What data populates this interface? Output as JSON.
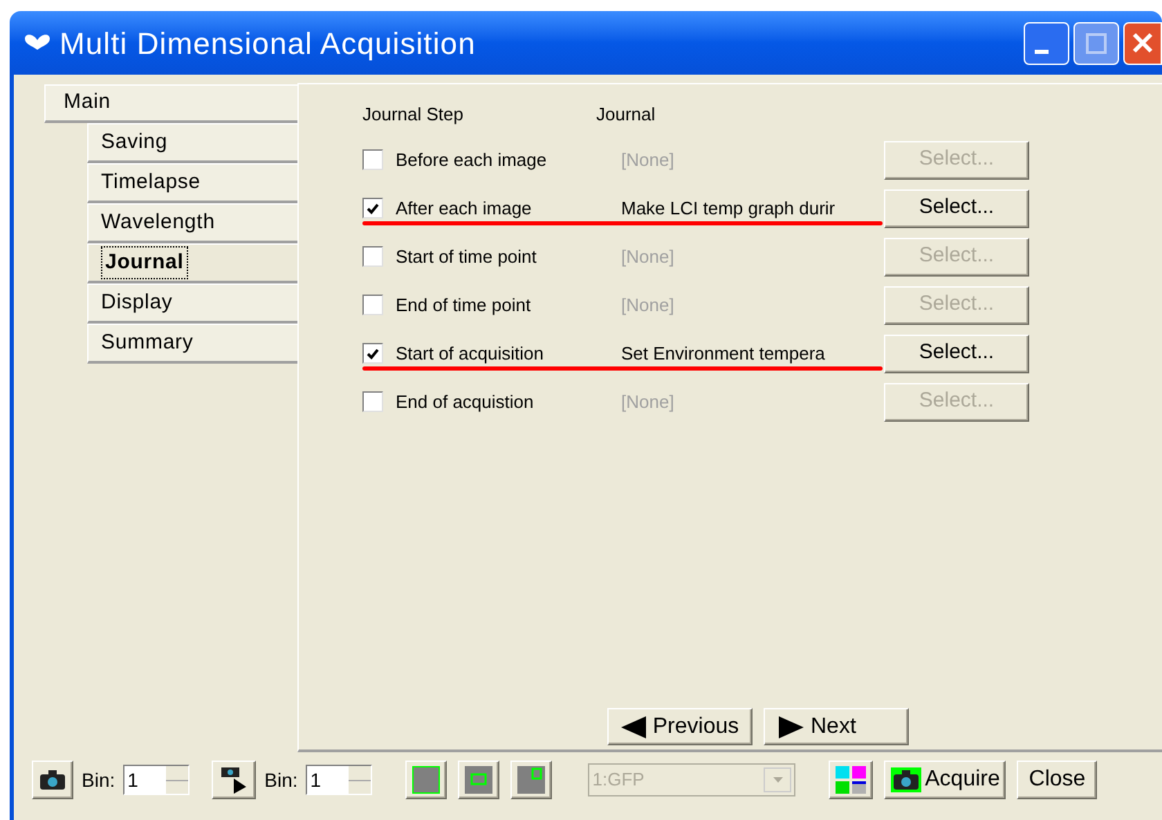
{
  "window": {
    "title": "Multi Dimensional Acquisition"
  },
  "tabs": [
    {
      "label": "Main",
      "selected": false,
      "kind": "top"
    },
    {
      "label": "Saving",
      "selected": false,
      "kind": "sub"
    },
    {
      "label": "Timelapse",
      "selected": false,
      "kind": "sub"
    },
    {
      "label": "Wavelength",
      "selected": false,
      "kind": "sub"
    },
    {
      "label": "Journal",
      "selected": true,
      "kind": "sub"
    },
    {
      "label": "Display",
      "selected": false,
      "kind": "sub"
    },
    {
      "label": "Summary",
      "selected": false,
      "kind": "sub"
    }
  ],
  "columns": [
    "Journal Step",
    "Journal"
  ],
  "steps": [
    {
      "label": "Before each image",
      "checked": false,
      "journal": "[None]",
      "button": "Select...",
      "underlined": false
    },
    {
      "label": "After each image",
      "checked": true,
      "journal": "Make LCI temp graph durir",
      "button": "Select...",
      "underlined": true
    },
    {
      "label": "Start of time point",
      "checked": false,
      "journal": "[None]",
      "button": "Select...",
      "underlined": false
    },
    {
      "label": "End of time point",
      "checked": false,
      "journal": "[None]",
      "button": "Select...",
      "underlined": false
    },
    {
      "label": "Start of acquisition",
      "checked": true,
      "journal": "Set Environment tempera",
      "button": "Select...",
      "underlined": true
    },
    {
      "label": "End of acquistion",
      "checked": false,
      "journal": "[None]",
      "button": "Select...",
      "underlined": false
    }
  ],
  "nav": {
    "previous": "Previous",
    "next": "Next"
  },
  "toolbar": {
    "bin_label_1": "Bin:",
    "bin_value_1": "1",
    "bin_label_2": "Bin:",
    "bin_value_2": "1",
    "channel": "1:GFP",
    "channel_disabled": true,
    "acquire": "Acquire",
    "close": "Close"
  }
}
